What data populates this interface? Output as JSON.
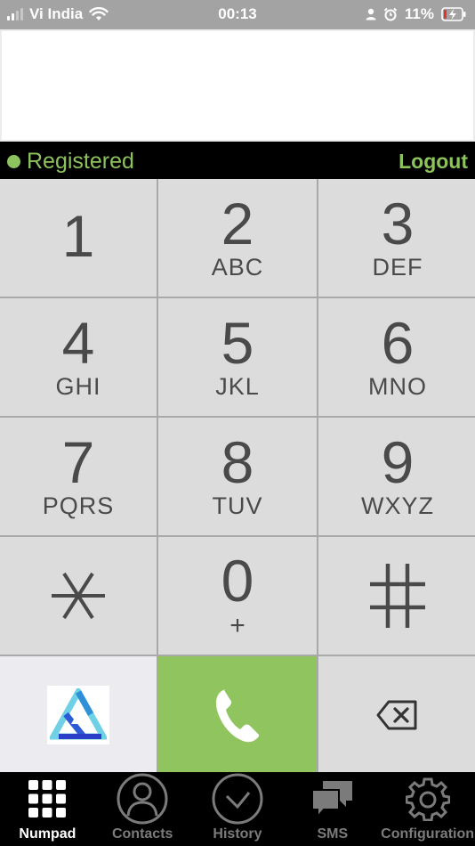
{
  "status_bar": {
    "carrier": "Vi India",
    "time": "00:13",
    "battery": "11%"
  },
  "dialer": {
    "number_value": "",
    "registration_status": "Registered",
    "logout_label": "Logout"
  },
  "keypad": {
    "keys": [
      {
        "digit": "1",
        "letters": ""
      },
      {
        "digit": "2",
        "letters": "ABC"
      },
      {
        "digit": "3",
        "letters": "DEF"
      },
      {
        "digit": "4",
        "letters": "GHI"
      },
      {
        "digit": "5",
        "letters": "JKL"
      },
      {
        "digit": "6",
        "letters": "MNO"
      },
      {
        "digit": "7",
        "letters": "PQRS"
      },
      {
        "digit": "8",
        "letters": "TUV"
      },
      {
        "digit": "9",
        "letters": "WXYZ"
      },
      {
        "digit": "0",
        "letters": "+"
      }
    ]
  },
  "colors": {
    "accent_green": "#8cc35c",
    "call_button": "#8fc45e",
    "key_background": "#dcdcdc",
    "status_bar": "#a3a3a3"
  },
  "tabs": [
    {
      "label": "Numpad",
      "icon": "grid-icon",
      "active": true
    },
    {
      "label": "Contacts",
      "icon": "person-icon",
      "active": false
    },
    {
      "label": "History",
      "icon": "clock-icon",
      "active": false
    },
    {
      "label": "SMS",
      "icon": "chat-bubbles-icon",
      "active": false
    },
    {
      "label": "Configuration",
      "icon": "gear-icon",
      "active": false
    }
  ]
}
